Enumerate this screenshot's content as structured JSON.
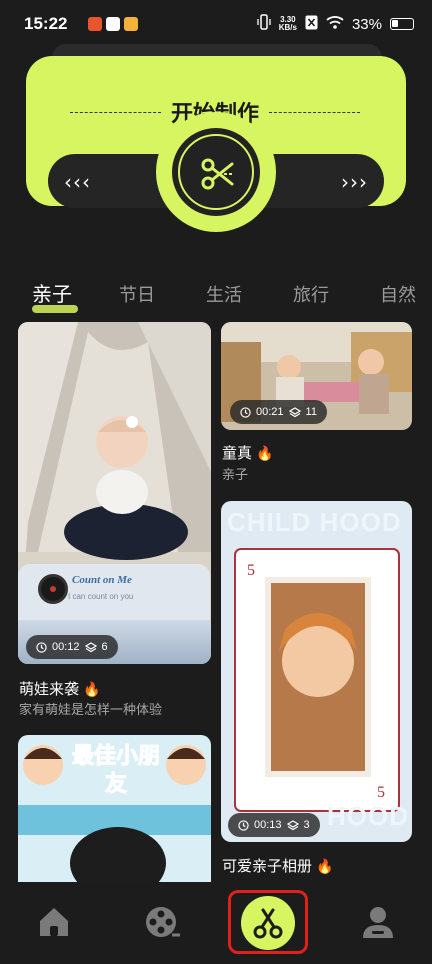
{
  "status_bar": {
    "time": "15:22",
    "net_speed_value": "3.30",
    "net_speed_unit": "KB/s",
    "battery": "33%"
  },
  "hero": {
    "title": "开始制作",
    "left_chevrons": "‹‹‹",
    "right_chevrons": "›››",
    "create_icon": "scissors-icon",
    "accent_color": "#d7f560"
  },
  "tabs": [
    "亲子",
    "节日",
    "生活",
    "旅行",
    "自然"
  ],
  "active_tab": "亲子",
  "cards": [
    {
      "title": "萌娃来袭",
      "subtitle": "家有萌娃是怎样一种体验",
      "duration": "00:12",
      "layers": "6",
      "music_title": "Count on Me",
      "music_lyric": "I can count on you"
    },
    {
      "title": "童真",
      "subtitle": "亲子",
      "duration": "00:21",
      "layers": "11"
    },
    {
      "title": "可爱亲子相册",
      "subtitle": "",
      "duration": "00:13",
      "layers": "3",
      "poster_text_top": "CHILD HOOD",
      "poster_text_bottom": "HOOD"
    },
    {
      "poster_text": "最佳小朋友"
    }
  ],
  "bottom_nav": {
    "items": [
      "home-icon",
      "film-reel-icon",
      "scissors-icon",
      "profile-icon"
    ],
    "active": "scissors-icon"
  }
}
